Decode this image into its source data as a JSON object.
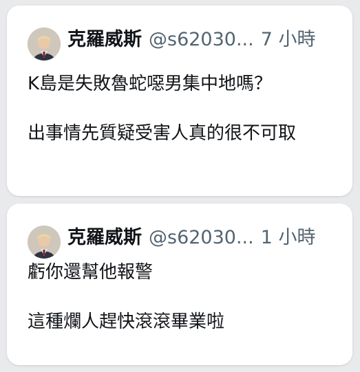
{
  "posts": [
    {
      "display_name": "克羅威斯",
      "handle": "@s62030...",
      "time": "7 小時",
      "paragraphs": [
        "K島是失敗魯蛇噁男集中地嗎？",
        "出事情先質疑受害人真的很不可取"
      ]
    },
    {
      "display_name": "克羅威斯",
      "handle": "@s62030...",
      "time": "1 小時",
      "paragraphs": [
        "虧你還幫他報警",
        "這種爛人趕快滾滾畢業啦"
      ]
    }
  ]
}
